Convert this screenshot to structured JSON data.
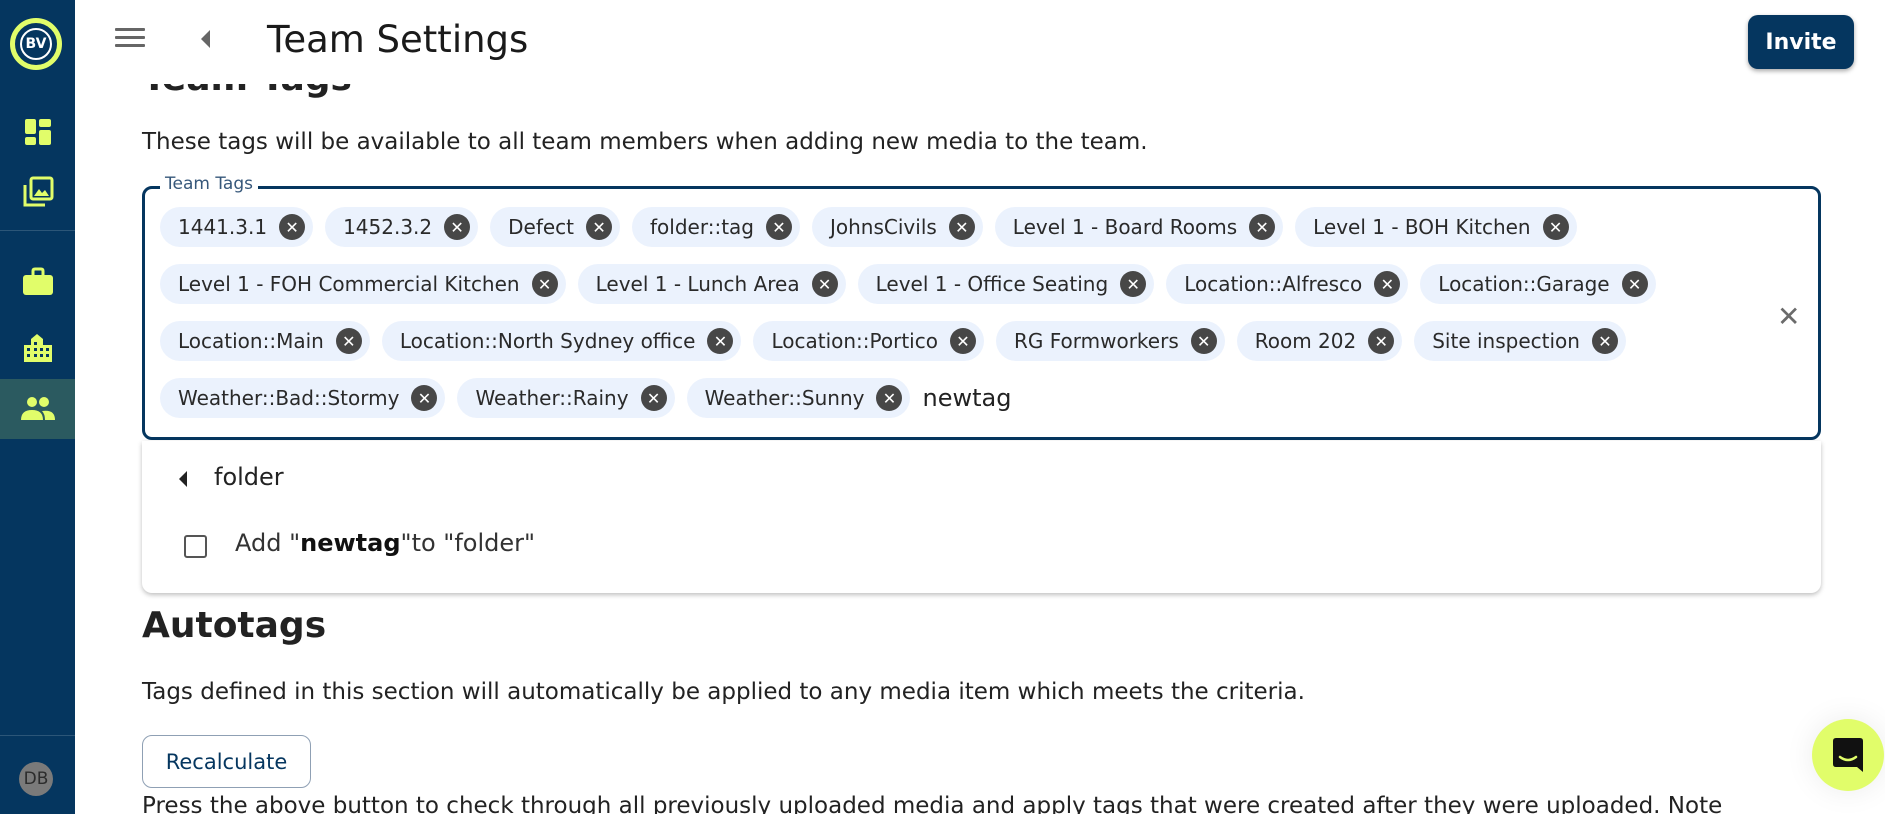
{
  "app": {
    "logo_text": "BV",
    "user_initials": "DB"
  },
  "sidebar": {
    "items": [
      {
        "icon": "dashboard-icon",
        "active": false
      },
      {
        "icon": "media-gallery-icon",
        "active": false
      },
      {
        "icon": "briefcase-icon",
        "active": false
      },
      {
        "icon": "building-icon",
        "active": false
      },
      {
        "icon": "team-icon",
        "active": true
      }
    ]
  },
  "header": {
    "title": "Team Settings",
    "invite_label": "Invite"
  },
  "team_tags": {
    "heading": "Team Tags",
    "description": "These tags will be available to all team members when adding new media to the team.",
    "field_label": "Team Tags",
    "tags": [
      "1441.3.1",
      "1452.3.2",
      "Defect",
      "folder::tag",
      "JohnsCivils",
      "Level 1 - Board Rooms",
      "Level 1 - BOH Kitchen",
      "Level 1 - FOH Commercial Kitchen",
      "Level 1 - Lunch Area",
      "Level 1 - Office Seating",
      "Location::Alfresco",
      "Location::Garage",
      "Location::Main",
      "Location::North Sydney office",
      "Location::Portico",
      "RG Formworkers",
      "Room 202",
      "Site inspection",
      "Weather::Bad::Stormy",
      "Weather::Rainy",
      "Weather::Sunny"
    ],
    "input_value": "newtag"
  },
  "dropdown": {
    "folder_label": "folder",
    "add_prefix": "Add \"",
    "add_tag": "newtag",
    "add_suffix": "\"to \"folder\"",
    "checked": false
  },
  "autotags": {
    "heading": "Autotags",
    "description": "Tags defined in this section will automatically be applied to any media item which meets the criteria.",
    "recalculate_label": "Recalculate",
    "note": "Press the above button to check through all previously uploaded media and apply tags that were created after they were uploaded. Note"
  },
  "colors": {
    "brand_navy": "#05365f",
    "accent_lime": "#e1fd6a",
    "chip_bg": "#ebf2fd"
  }
}
